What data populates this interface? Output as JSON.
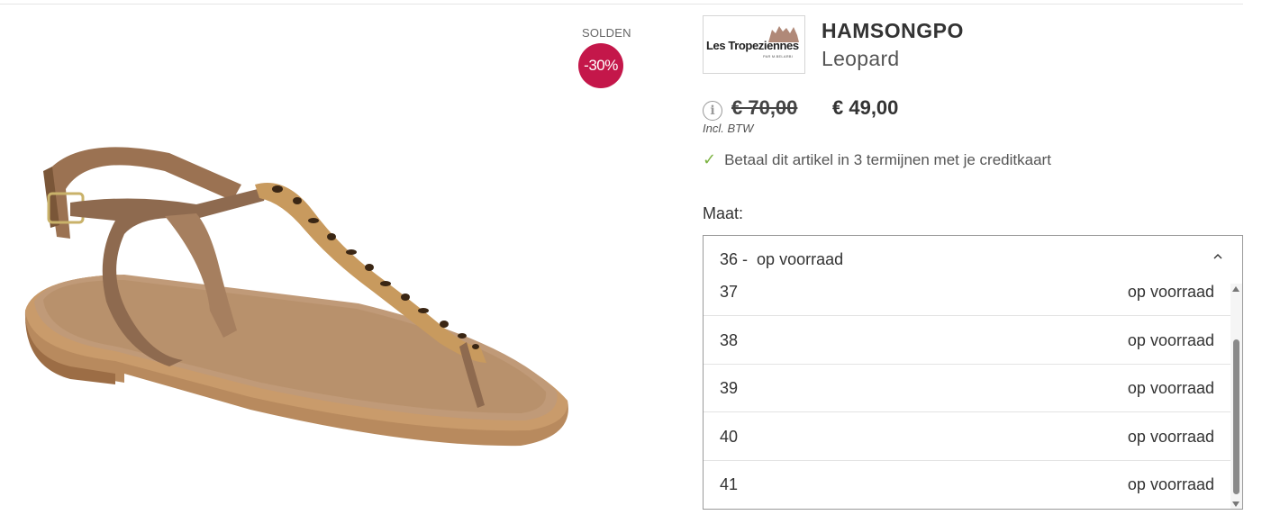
{
  "sale": {
    "label": "SOLDEN",
    "badge": "-30%"
  },
  "brand": {
    "logo_text": "Les Tropeziennes",
    "logo_sub": "PAR M.BELARBI"
  },
  "product": {
    "name": "HAMSONGPO",
    "variant": "Leopard"
  },
  "price": {
    "old": "€ 70,00",
    "new": "€ 49,00",
    "vat_note": "Incl. BTW"
  },
  "installment": {
    "text": "Betaal dit artikel in 3 termijnen met je creditkaart"
  },
  "size": {
    "label": "Maat:",
    "selected_size": "36 -",
    "selected_status": "op voorraad",
    "options": [
      {
        "size": "37",
        "status": "op voorraad"
      },
      {
        "size": "38",
        "status": "op voorraad"
      },
      {
        "size": "39",
        "status": "op voorraad"
      },
      {
        "size": "40",
        "status": "op voorraad"
      },
      {
        "size": "41",
        "status": "op voorraad"
      }
    ]
  },
  "colors": {
    "sale_badge": "#c4174a",
    "check": "#7cb342"
  }
}
